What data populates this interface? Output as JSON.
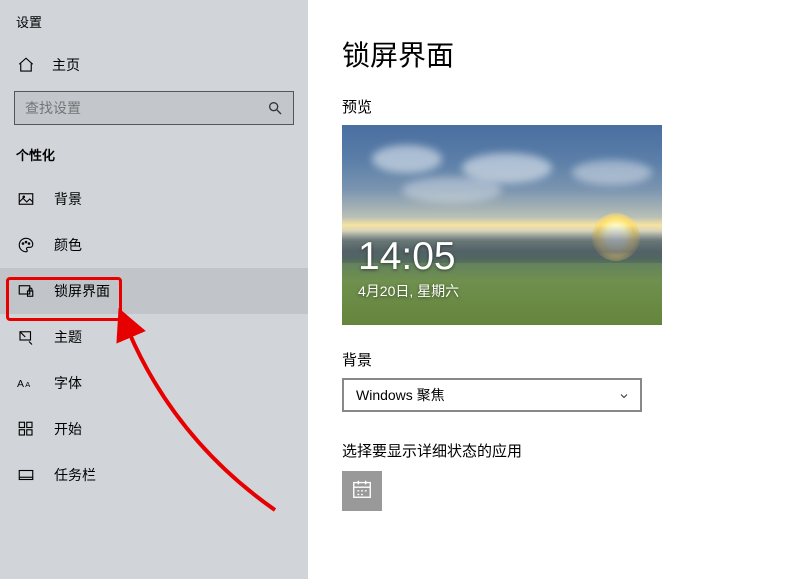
{
  "sidebar": {
    "app_title": "设置",
    "home_label": "主页",
    "search_placeholder": "查找设置",
    "section_header": "个性化",
    "items": [
      {
        "label": "背景"
      },
      {
        "label": "颜色"
      },
      {
        "label": "锁屏界面"
      },
      {
        "label": "主题"
      },
      {
        "label": "字体"
      },
      {
        "label": "开始"
      },
      {
        "label": "任务栏"
      }
    ]
  },
  "main": {
    "title": "锁屏界面",
    "preview_label": "预览",
    "preview_time": "14:05",
    "preview_date": "4月20日, 星期六",
    "bg_label": "背景",
    "bg_value": "Windows 聚焦",
    "status_label": "选择要显示详细状态的应用"
  }
}
